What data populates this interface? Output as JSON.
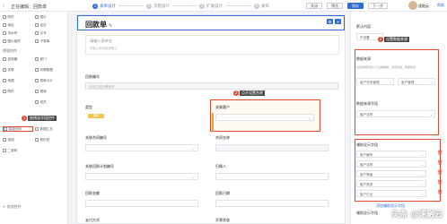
{
  "topbar": {
    "back_label": "‹",
    "editing_label": "正在编辑：回款单",
    "steps": [
      {
        "num": "1",
        "label": "表单设计"
      },
      {
        "num": "2",
        "label": "流程设计"
      },
      {
        "num": "3",
        "label": "扩展设计"
      },
      {
        "num": "4",
        "label": "发布"
      }
    ],
    "buttons": {
      "close": "关闭",
      "preview": "预览",
      "save": "保存",
      "next": "下一步"
    },
    "help": "帮助",
    "user_name": "速融云"
  },
  "left_panel": {
    "items_top": [
      "附件",
      "图片",
      "地址",
      "定位",
      "流水号",
      "手写",
      "图片组件",
      "子表单"
    ],
    "section_advanced": "增强控件",
    "items_adv": [
      "选择器",
      "部门",
      "关联",
      "关联数据",
      "地图",
      "表单卡片",
      "附件",
      "搜索",
      "成员",
      "数据汇总",
      "智能扫码",
      "按钮",
      "条形码",
      "二维码"
    ],
    "section_more": "+ 其他控件",
    "highlighted_item": "智能扫码"
  },
  "callouts": {
    "one": {
      "num": "1",
      "text": "拖拽该字段控件"
    },
    "two": {
      "num": "2",
      "text": "点开设置名称"
    },
    "three": {
      "num": "3",
      "text": "设置数据来源"
    }
  },
  "form": {
    "title": "回款单",
    "desc_placeholder": "请输入表单名",
    "desc_sub": "请输入表单描述备注",
    "fields": {
      "code_label": "回款编号",
      "code_hint": "自动生成无需填写",
      "type_label": "类型",
      "type_tag": "回款",
      "customer_label": "关联客户",
      "contract_label": "关联合同编号",
      "contract_name_label": "合同名称",
      "plan_label": "关联回款计划编号",
      "applicant_label": "归属人",
      "amount_label": "回款金额",
      "date_label": "回款日期",
      "method_label": "支付方式",
      "status_label": "开票状态"
    }
  },
  "right_panel": {
    "default_label": "默认内容",
    "default_value": "不设置",
    "source_label": "数据来源",
    "source_hint": "将选择绑定到以下表单数据，支持筛选、数据联动",
    "source_a": "客户关系管理",
    "source_b": "客户管理",
    "field_label": "数据来源字段",
    "field_value": "客户名称",
    "aux_label": "辅助显示字段",
    "aux_rows": [
      "客户编号",
      "客户名称",
      "客户等级",
      "客户类型",
      "客户行业"
    ],
    "add_link": "添加辅助显示字段",
    "aux_label2": "辅助显示字段"
  },
  "watermark": "头条 @速融云",
  "colors": {
    "accent": "#2f6bd8",
    "annotation": "#e0482f",
    "tag": "#f3c34d"
  }
}
